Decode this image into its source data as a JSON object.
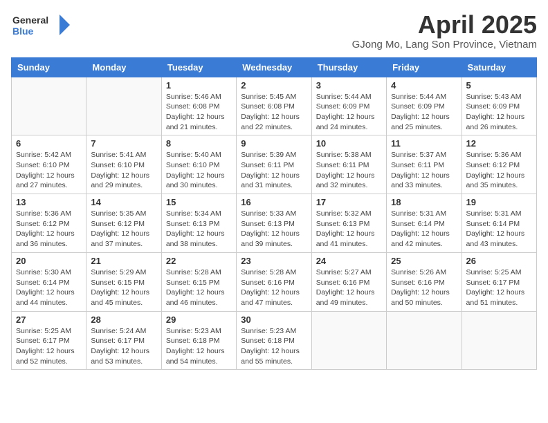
{
  "header": {
    "logo_general": "General",
    "logo_blue": "Blue",
    "month_title": "April 2025",
    "location": "GJong Mo, Lang Son Province, Vietnam"
  },
  "weekdays": [
    "Sunday",
    "Monday",
    "Tuesday",
    "Wednesday",
    "Thursday",
    "Friday",
    "Saturday"
  ],
  "weeks": [
    [
      {
        "day": "",
        "info": ""
      },
      {
        "day": "",
        "info": ""
      },
      {
        "day": "1",
        "info": "Sunrise: 5:46 AM\nSunset: 6:08 PM\nDaylight: 12 hours and 21 minutes."
      },
      {
        "day": "2",
        "info": "Sunrise: 5:45 AM\nSunset: 6:08 PM\nDaylight: 12 hours and 22 minutes."
      },
      {
        "day": "3",
        "info": "Sunrise: 5:44 AM\nSunset: 6:09 PM\nDaylight: 12 hours and 24 minutes."
      },
      {
        "day": "4",
        "info": "Sunrise: 5:44 AM\nSunset: 6:09 PM\nDaylight: 12 hours and 25 minutes."
      },
      {
        "day": "5",
        "info": "Sunrise: 5:43 AM\nSunset: 6:09 PM\nDaylight: 12 hours and 26 minutes."
      }
    ],
    [
      {
        "day": "6",
        "info": "Sunrise: 5:42 AM\nSunset: 6:10 PM\nDaylight: 12 hours and 27 minutes."
      },
      {
        "day": "7",
        "info": "Sunrise: 5:41 AM\nSunset: 6:10 PM\nDaylight: 12 hours and 29 minutes."
      },
      {
        "day": "8",
        "info": "Sunrise: 5:40 AM\nSunset: 6:10 PM\nDaylight: 12 hours and 30 minutes."
      },
      {
        "day": "9",
        "info": "Sunrise: 5:39 AM\nSunset: 6:11 PM\nDaylight: 12 hours and 31 minutes."
      },
      {
        "day": "10",
        "info": "Sunrise: 5:38 AM\nSunset: 6:11 PM\nDaylight: 12 hours and 32 minutes."
      },
      {
        "day": "11",
        "info": "Sunrise: 5:37 AM\nSunset: 6:11 PM\nDaylight: 12 hours and 33 minutes."
      },
      {
        "day": "12",
        "info": "Sunrise: 5:36 AM\nSunset: 6:12 PM\nDaylight: 12 hours and 35 minutes."
      }
    ],
    [
      {
        "day": "13",
        "info": "Sunrise: 5:36 AM\nSunset: 6:12 PM\nDaylight: 12 hours and 36 minutes."
      },
      {
        "day": "14",
        "info": "Sunrise: 5:35 AM\nSunset: 6:12 PM\nDaylight: 12 hours and 37 minutes."
      },
      {
        "day": "15",
        "info": "Sunrise: 5:34 AM\nSunset: 6:13 PM\nDaylight: 12 hours and 38 minutes."
      },
      {
        "day": "16",
        "info": "Sunrise: 5:33 AM\nSunset: 6:13 PM\nDaylight: 12 hours and 39 minutes."
      },
      {
        "day": "17",
        "info": "Sunrise: 5:32 AM\nSunset: 6:13 PM\nDaylight: 12 hours and 41 minutes."
      },
      {
        "day": "18",
        "info": "Sunrise: 5:31 AM\nSunset: 6:14 PM\nDaylight: 12 hours and 42 minutes."
      },
      {
        "day": "19",
        "info": "Sunrise: 5:31 AM\nSunset: 6:14 PM\nDaylight: 12 hours and 43 minutes."
      }
    ],
    [
      {
        "day": "20",
        "info": "Sunrise: 5:30 AM\nSunset: 6:14 PM\nDaylight: 12 hours and 44 minutes."
      },
      {
        "day": "21",
        "info": "Sunrise: 5:29 AM\nSunset: 6:15 PM\nDaylight: 12 hours and 45 minutes."
      },
      {
        "day": "22",
        "info": "Sunrise: 5:28 AM\nSunset: 6:15 PM\nDaylight: 12 hours and 46 minutes."
      },
      {
        "day": "23",
        "info": "Sunrise: 5:28 AM\nSunset: 6:16 PM\nDaylight: 12 hours and 47 minutes."
      },
      {
        "day": "24",
        "info": "Sunrise: 5:27 AM\nSunset: 6:16 PM\nDaylight: 12 hours and 49 minutes."
      },
      {
        "day": "25",
        "info": "Sunrise: 5:26 AM\nSunset: 6:16 PM\nDaylight: 12 hours and 50 minutes."
      },
      {
        "day": "26",
        "info": "Sunrise: 5:25 AM\nSunset: 6:17 PM\nDaylight: 12 hours and 51 minutes."
      }
    ],
    [
      {
        "day": "27",
        "info": "Sunrise: 5:25 AM\nSunset: 6:17 PM\nDaylight: 12 hours and 52 minutes."
      },
      {
        "day": "28",
        "info": "Sunrise: 5:24 AM\nSunset: 6:17 PM\nDaylight: 12 hours and 53 minutes."
      },
      {
        "day": "29",
        "info": "Sunrise: 5:23 AM\nSunset: 6:18 PM\nDaylight: 12 hours and 54 minutes."
      },
      {
        "day": "30",
        "info": "Sunrise: 5:23 AM\nSunset: 6:18 PM\nDaylight: 12 hours and 55 minutes."
      },
      {
        "day": "",
        "info": ""
      },
      {
        "day": "",
        "info": ""
      },
      {
        "day": "",
        "info": ""
      }
    ]
  ]
}
